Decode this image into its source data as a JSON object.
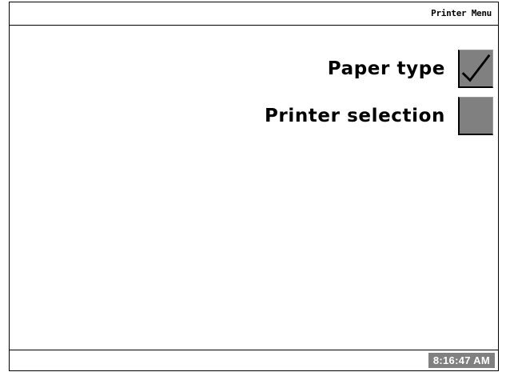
{
  "header": {
    "title": "Printer Menu"
  },
  "menu": {
    "items": [
      {
        "label": "Paper type",
        "checked": true,
        "icon": "checkmark-icon"
      },
      {
        "label": "Printer selection",
        "checked": false,
        "icon": ""
      }
    ]
  },
  "status": {
    "time": "8:16:47 AM"
  },
  "colors": {
    "button_fill": "#808080",
    "border": "#000000",
    "clock_text": "#ffffff"
  }
}
